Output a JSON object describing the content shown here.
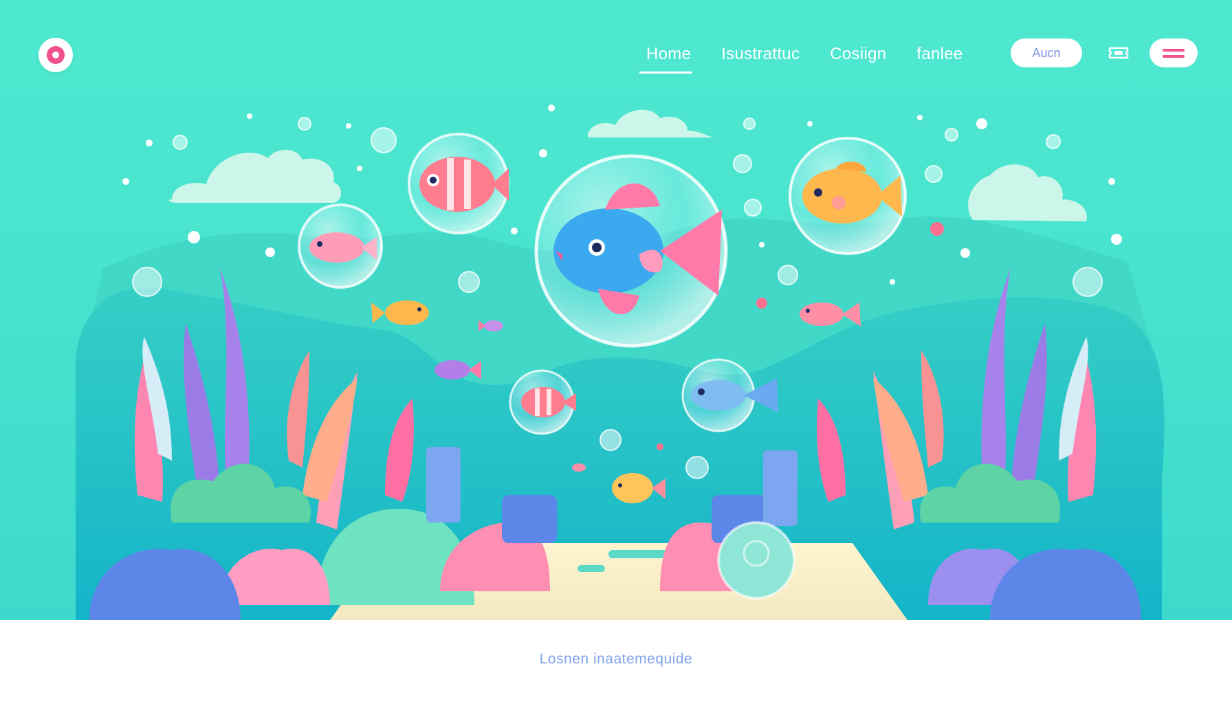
{
  "nav": {
    "links": [
      {
        "label": "Home",
        "active": true
      },
      {
        "label": "Isustrattuc",
        "active": false
      },
      {
        "label": "Cosiign",
        "active": false
      },
      {
        "label": "fanlee",
        "active": false
      }
    ],
    "button_label": "Aucn",
    "icons": {
      "logo": "logo-icon",
      "ticket": "ticket-icon",
      "menu": "menu-icon"
    }
  },
  "footer": {
    "text": "Losnen inaatemequide"
  },
  "colors": {
    "background": "#4fe8d0",
    "accent": "#f0508c",
    "button_text": "#7a8fe0",
    "footer_text": "#7fa3ec"
  }
}
